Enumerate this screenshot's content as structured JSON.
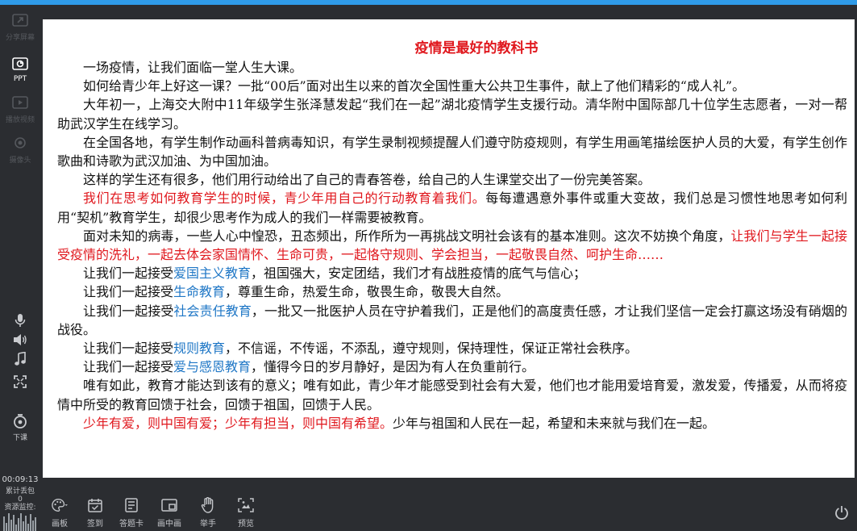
{
  "sidebar": {
    "items": [
      {
        "label": "分享屏幕",
        "icon": "share-screen-icon",
        "state": "dim"
      },
      {
        "label": "PPT",
        "icon": "ppt-icon",
        "state": "active"
      },
      {
        "label": "播放视频",
        "icon": "play-video-icon",
        "state": "dim"
      },
      {
        "label": "摄像头",
        "icon": "camera-icon",
        "state": "dim"
      }
    ],
    "end_class_label": "下课",
    "timer": "00:09:13",
    "packet_loss_label": "累计丢包",
    "packet_loss_value": "0",
    "resource_monitor_label": "资源监控:"
  },
  "slide": {
    "title": "疫情是最好的教科书",
    "p1": "一场疫情，让我们面临一堂人生大课。",
    "p2": "如何给青少年上好这一课？一批“00后”面对出生以来的首次全国性重大公共卫生事件，献上了他们精彩的“成人礼”。",
    "p3": "大年初一，上海交大附中11年级学生张泽慧发起“我们在一起”湖北疫情学生支援行动。清华附中国际部几十位学生志愿者，一对一帮助武汉学生在线学习。",
    "p4": "在全国各地，有学生制作动画科普病毒知识，有学生录制视频提醒人们遵守防疫规则，有学生用画笔描绘医护人员的大爱，有学生创作歌曲和诗歌为武汉加油、为中国加油。",
    "p5": "这样的学生还有很多，他们用行动给出了自己的青春答卷，给自己的人生课堂交出了一份完美答案。",
    "p6_red": "我们在思考如何教育学生的时候，青少年用自己的行动教育着我们。",
    "p6_rest": "每每遭遇意外事件或重大变故，我们总是习惯性地思考如何利用“契机”教育学生，却很少思考作为成人的我们一样需要被教育。",
    "p7_start": "面对未知的病毒，一些人心中惶恐，丑态频出，所作所为一再挑战文明社会该有的基本准则。这次不妨换个角度，",
    "p7_red": "让我们与学生一起接受疫情的洗礼，一起去体会家国情怀、生命可贵，一起恪守规则、学会担当，一起敬畏自然、呵护生命……",
    "l_prefix": "让我们一起接受",
    "l1_blue": "爱国主义教育",
    "l1_rest": "，祖国强大，安定团结，我们才有战胜疫情的底气与信心；",
    "l2_blue": "生命教育",
    "l2_rest": "，尊重生命，热爱生命，敬畏生命，敬畏大自然。",
    "l3_blue": "社会责任教育",
    "l3_rest": "，一批又一批医护人员在守护着我们，正是他们的高度责任感，才让我们坚信一定会打赢这场没有硝烟的战役。",
    "l4_blue": "规则教育",
    "l4_rest": "，不信谣，不传谣，不添乱，遵守规则，保持理性，保证正常社会秩序。",
    "l5_blue": "爱与感恩教育",
    "l5_rest": "，懂得今日的岁月静好，是因为有人在负重前行。",
    "p8": "唯有如此，教育才能达到该有的意义；唯有如此，青少年才能感受到社会有大爱，他们也才能用爱培育爱，激发爱，传播爱，从而将疫情中所受的教育回馈于社会，回馈于祖国，回馈于人民。",
    "p9_red": "少年有爱，则中国有爱；少年有担当，则中国有希望。",
    "p9_rest": "少年与祖国和人民在一起，希望和未来就与我们在一起。"
  },
  "toolbar": {
    "items": [
      {
        "label": "画板",
        "icon": "palette-icon"
      },
      {
        "label": "签到",
        "icon": "checkin-icon"
      },
      {
        "label": "答题卡",
        "icon": "answer-card-icon"
      },
      {
        "label": "画中画",
        "icon": "picture-in-picture-icon"
      },
      {
        "label": "举手",
        "icon": "raise-hand-icon"
      },
      {
        "label": "预览",
        "icon": "preview-icon"
      }
    ]
  },
  "colors": {
    "accent": "#2f9be8",
    "highlight_red": "#e0181e",
    "highlight_blue": "#1f77c6"
  }
}
